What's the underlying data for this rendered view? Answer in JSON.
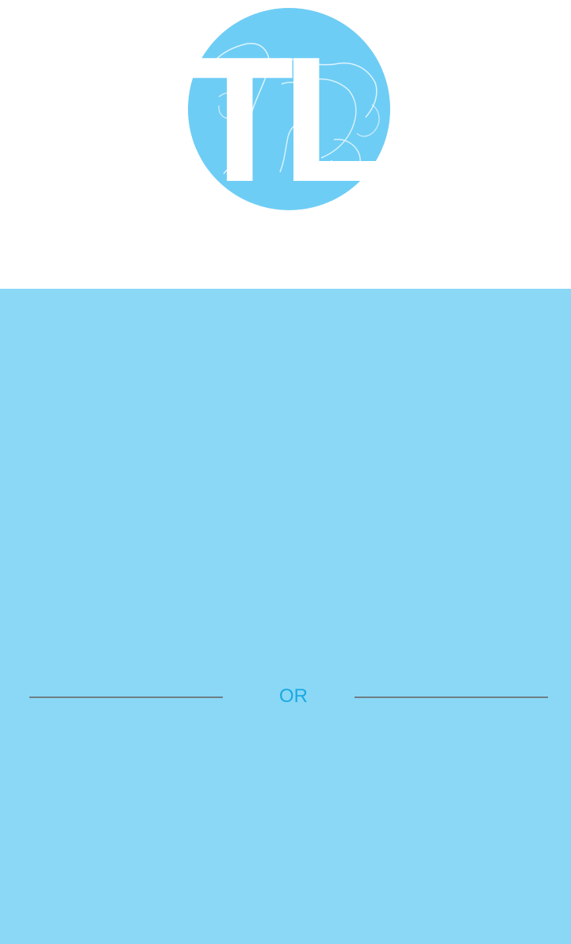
{
  "brand": {
    "logo_letters": "TL",
    "logo_color": "#6ecdf5"
  },
  "main": {
    "background_color": "#8ad8f6",
    "divider_text": "OR",
    "divider_text_color": "#1ca9e1"
  }
}
